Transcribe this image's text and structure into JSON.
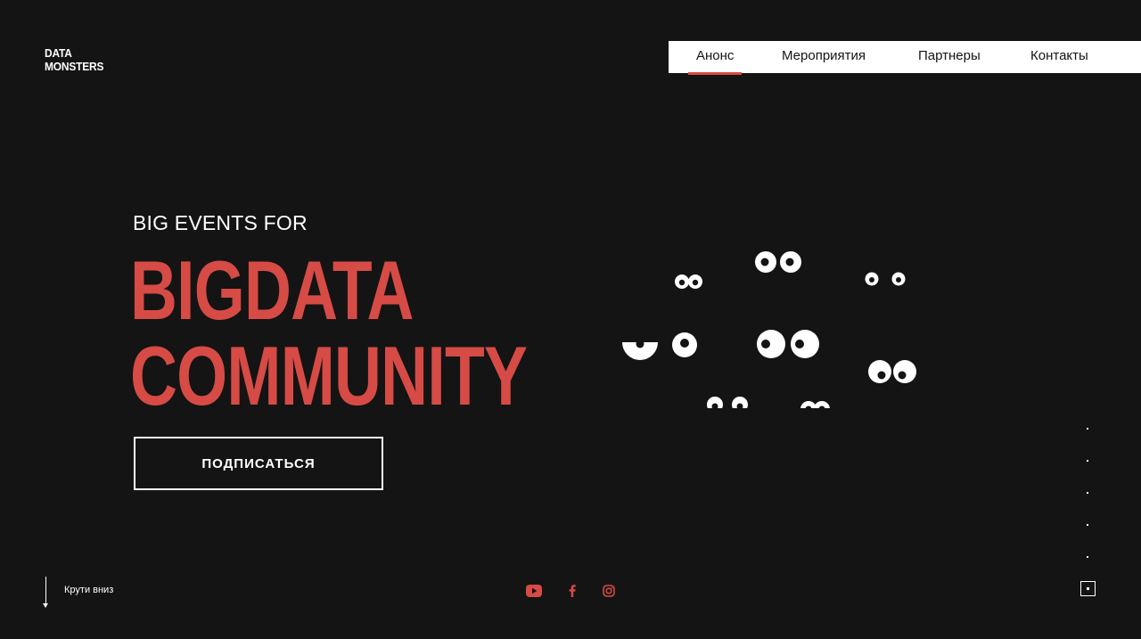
{
  "logo": {
    "line1": "DATA",
    "line2": "MONSTERS"
  },
  "nav": {
    "items": [
      {
        "label": "Анонс",
        "active": true
      },
      {
        "label": "Мероприятия",
        "active": false
      },
      {
        "label": "Партнеры",
        "active": false
      },
      {
        "label": "Контакты",
        "active": false
      }
    ]
  },
  "hero": {
    "subtitle": "BIG EVENTS FOR",
    "headline_line1": "BIGDATA",
    "headline_line2": "COMMUNITY",
    "cta_label": "ПОДПИСАТЬСЯ"
  },
  "scroll_hint": {
    "label": "Крути вниз",
    "icon": "arrow-down-icon"
  },
  "social": {
    "items": [
      {
        "name": "youtube-icon"
      },
      {
        "name": "facebook-icon"
      },
      {
        "name": "instagram-icon"
      }
    ]
  },
  "pagination": {
    "total": 6,
    "active_index": 6
  },
  "colors": {
    "background": "#141414",
    "accent": "#d64b45",
    "text": "#ffffff",
    "nav_background": "#ffffff"
  }
}
